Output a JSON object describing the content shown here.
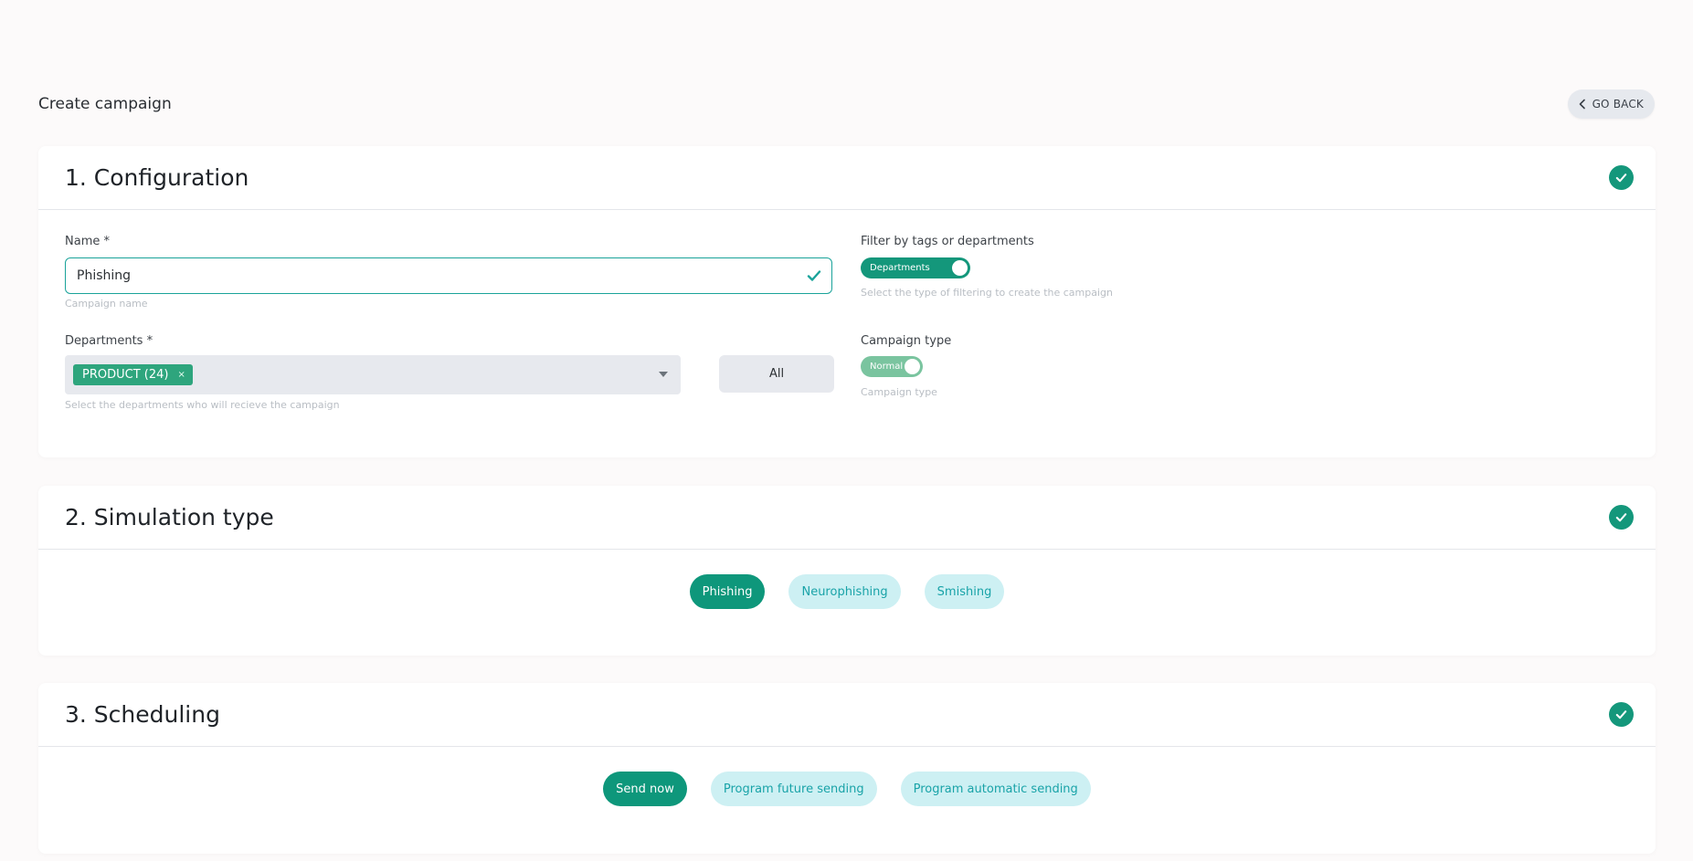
{
  "header": {
    "title": "Create campaign",
    "go_back_label": "GO BACK"
  },
  "configuration": {
    "title": "1. Configuration",
    "name": {
      "label": "Name *",
      "value": "Phishing",
      "helper": "Campaign name"
    },
    "departments": {
      "label": "Departments *",
      "selected_chip": "PRODUCT (24)",
      "chip_remove": "×",
      "helper": "Select the departments who will recieve the campaign",
      "all_button": "All"
    },
    "filter": {
      "label": "Filter by tags or departments",
      "toggle_label": "Departments",
      "helper": "Select the type of filtering to create the campaign"
    },
    "campaign_type": {
      "label": "Campaign type",
      "toggle_label": "Normal",
      "helper": "Campaign type"
    }
  },
  "simulation": {
    "title": "2. Simulation type",
    "options": [
      "Phishing",
      "Neurophishing",
      "Smishing"
    ],
    "selected": "Phishing"
  },
  "scheduling": {
    "title": "3. Scheduling",
    "options": [
      "Send now",
      "Program future sending",
      "Program automatic sending"
    ],
    "selected": "Send now"
  },
  "colors": {
    "accent": "#14977b",
    "pill_inactive_bg": "#cdf0f3",
    "pill_inactive_text": "#19a3a8",
    "input_border": "#1aa39a"
  }
}
